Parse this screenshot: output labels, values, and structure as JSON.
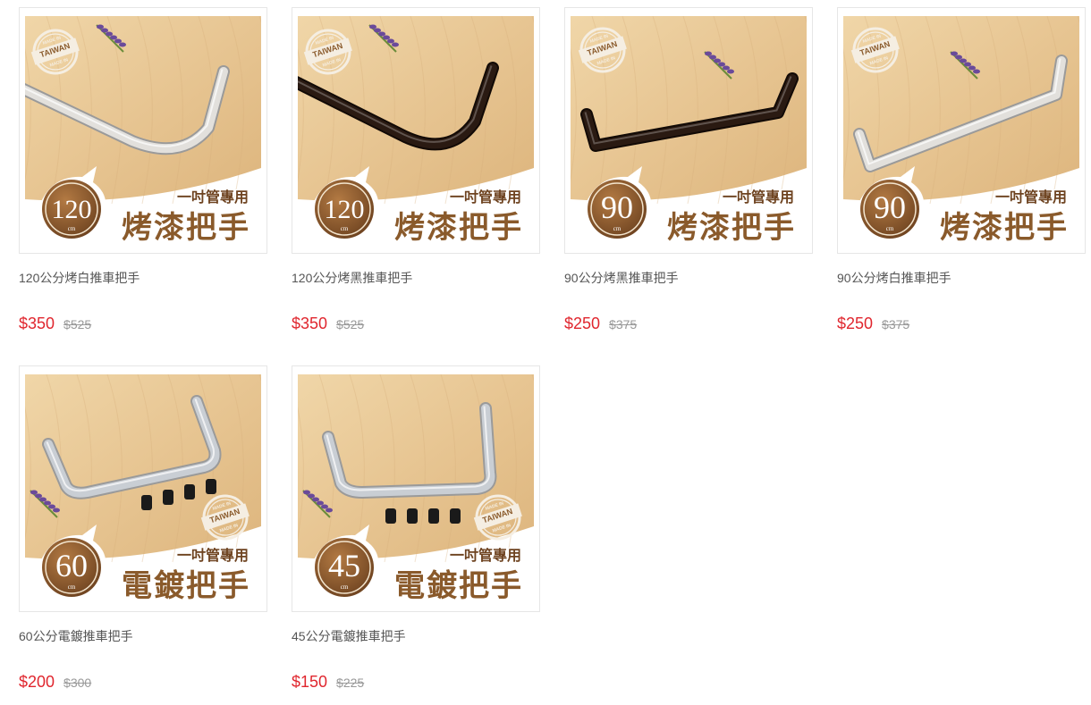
{
  "products": [
    {
      "name": "120公分烤白推車把手",
      "price": "$350",
      "original_price": "$525",
      "image": {
        "size_value": "120",
        "size_unit": "cm",
        "subtitle": "一吋管專用",
        "title": "烤漆把手",
        "badge_lines": [
          "MADE IN",
          "TAIWAN",
          "MADE IN"
        ],
        "handle_color": "#e2e0dc",
        "handle_shape": "corner-white"
      }
    },
    {
      "name": "120公分烤黑推車把手",
      "price": "$350",
      "original_price": "$525",
      "image": {
        "size_value": "120",
        "size_unit": "cm",
        "subtitle": "一吋管專用",
        "title": "烤漆把手",
        "badge_lines": [
          "MADE IN",
          "TAIWAN",
          "MADE IN"
        ],
        "handle_color": "#2a1a12",
        "handle_shape": "corner-black"
      }
    },
    {
      "name": "90公分烤黑推車把手",
      "price": "$250",
      "original_price": "$375",
      "image": {
        "size_value": "90",
        "size_unit": "cm",
        "subtitle": "一吋管專用",
        "title": "烤漆把手",
        "badge_lines": [
          "MADE IN",
          "TAIWAN",
          "MADE IN"
        ],
        "handle_color": "#2a1a12",
        "handle_shape": "long-black"
      }
    },
    {
      "name": "90公分烤白推車把手",
      "price": "$250",
      "original_price": "$375",
      "image": {
        "size_value": "90",
        "size_unit": "cm",
        "subtitle": "一吋管專用",
        "title": "烤漆把手",
        "badge_lines": [
          "MADE IN",
          "TAIWAN",
          "MADE IN"
        ],
        "handle_color": "#e2e0dc",
        "handle_shape": "long-white"
      }
    },
    {
      "name": "60公分電鍍推車把手",
      "price": "$200",
      "original_price": "$300",
      "image": {
        "size_value": "60",
        "size_unit": "cm",
        "subtitle": "一吋管專用",
        "title": "電鍍把手",
        "badge_lines": [
          "MADE IN",
          "TAIWAN",
          "MADE IN"
        ],
        "handle_color": "#c9ced4",
        "handle_shape": "chrome-60"
      }
    },
    {
      "name": "45公分電鍍推車把手",
      "price": "$150",
      "original_price": "$225",
      "image": {
        "size_value": "45",
        "size_unit": "cm",
        "subtitle": "一吋管專用",
        "title": "電鍍把手",
        "badge_lines": [
          "MADE IN",
          "TAIWAN",
          "MADE IN"
        ],
        "handle_color": "#c9ced4",
        "handle_shape": "chrome-45"
      }
    }
  ],
  "colors": {
    "sale_price": "#e0262e",
    "original_price": "#999999",
    "product_name": "#555555",
    "wood": "#e8c896",
    "badge_brown": "#8a5a2b"
  }
}
